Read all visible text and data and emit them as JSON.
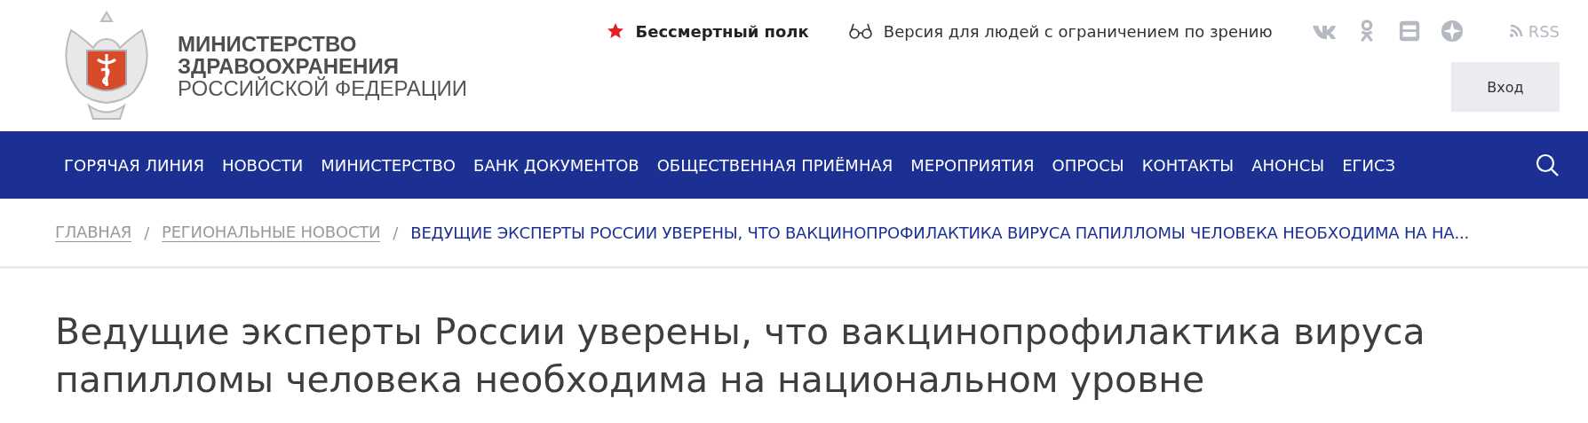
{
  "logo": {
    "lines": [
      "МИНИСТЕРСТВО",
      "ЗДРАВООХРАНЕНИЯ",
      "РОССИЙСКОЙ ФЕДЕРАЦИИ"
    ]
  },
  "top_links": [
    {
      "kind": "star",
      "label": "Бессмертный полк"
    },
    {
      "kind": "glasses",
      "label": "Версия для людей с ограничением по зрению"
    }
  ],
  "social": [
    {
      "kind": "vk"
    },
    {
      "kind": "ok"
    },
    {
      "kind": "youtube"
    },
    {
      "kind": "compass"
    }
  ],
  "rss": "RSS",
  "login_button": "Вход",
  "nav": [
    "ГОРЯЧАЯ ЛИНИЯ",
    "НОВОСТИ",
    "МИНИСТЕРСТВО",
    "БАНК ДОКУМЕНТОВ",
    "ОБЩЕСТВЕННАЯ ПРИЁМНАЯ",
    "МЕРОПРИЯТИЯ",
    "ОПРОСЫ",
    "КОНТАКТЫ",
    "АНОНСЫ",
    "ЕГИСЗ"
  ],
  "breadcrumbs": [
    {
      "label": "ГЛАВНАЯ",
      "current": false
    },
    {
      "label": "РЕГИОНАЛЬНЫЕ НОВОСТИ",
      "current": false
    },
    {
      "label": "ВЕДУЩИЕ ЭКСПЕРТЫ РОССИИ УВЕРЕНЫ, ЧТО ВАКЦИНОПРОФИЛАКТИКА ВИРУСА ПАПИЛЛОМЫ ЧЕЛОВЕКА НЕОБХОДИМА НА НА...",
      "current": true
    }
  ],
  "breadcrumb_separator": "/",
  "title": "Ведущие эксперты России уверены, что вакцинопрофилактика вируса папилломы человека необходима на национальном уровне"
}
